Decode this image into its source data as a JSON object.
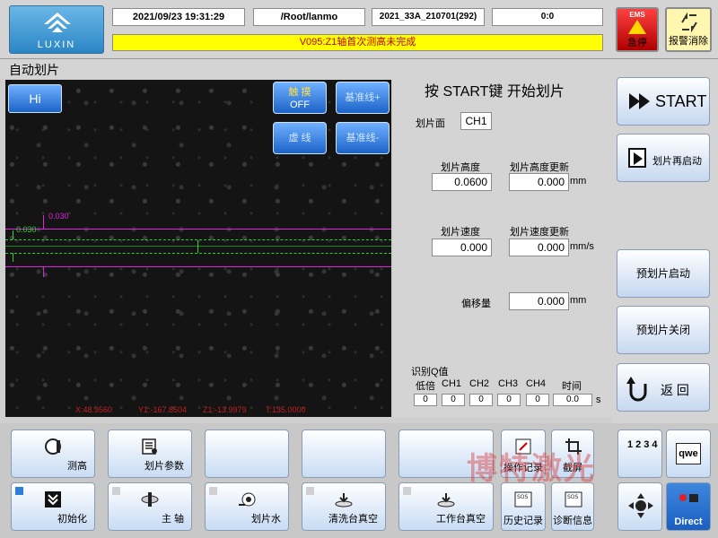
{
  "header": {
    "datetime": "2021/09/23 19:31:29",
    "path": "/Root/lanmo",
    "recipe": "2021_33A_210701(292)",
    "counter": "0:0",
    "alarm_message": "V095:Z1轴首次测高未完成",
    "logo_text": "LUXIN",
    "ems_top": "EMS",
    "ems_label": "急停",
    "alarm_clear_label": "报警消除"
  },
  "page_title": "自动划片",
  "camera": {
    "hi_label": "Hi",
    "touch_label_1": "触 摸",
    "touch_label_2": "OFF",
    "baseline_plus": "基准线+",
    "dashed_label": "虚 线",
    "baseline_minus": "基准线-",
    "marker_magenta": "0.030",
    "marker_green": "0.030",
    "status_x": "X:48.9560",
    "status_y": "Y1:-167.8504",
    "status_z": "Z1:-13.9979",
    "status_t": "T:135.0000",
    "colors": {
      "magenta": "#e020e0",
      "green": "#30d030"
    }
  },
  "panel": {
    "title": "按 START键 开始划片",
    "face_label": "划片面",
    "face_value": "CH1",
    "height_label": "划片高度",
    "height_value": "0.0600",
    "height_update_label": "划片高度更新",
    "height_update_value": "0.000",
    "height_unit": "mm",
    "speed_label": "划片速度",
    "speed_value": "0.000",
    "speed_update_label": "划片速度更新",
    "speed_update_value": "0.000",
    "speed_unit": "mm/s",
    "offset_label": "偏移量",
    "offset_value": "0.000",
    "offset_unit": "mm",
    "q_title": "识别Q值",
    "q_headers": [
      "低倍",
      "CH1",
      "CH2",
      "CH3",
      "CH4",
      "时间"
    ],
    "q_values": [
      "0",
      "0",
      "0",
      "0",
      "0",
      "0.0"
    ],
    "q_unit": "s"
  },
  "side": {
    "start": "START",
    "restart": "划片再启动",
    "pre_start": "预划片启动",
    "pre_close": "预划片关闭",
    "back": "返 回"
  },
  "bottom": {
    "measure": "测高",
    "params": "划片参数",
    "op_log": "操作记录",
    "screenshot": "截屏",
    "init": "初始化",
    "spindle": "主 轴",
    "water": "划片水",
    "clean_vac": "清洗台真空",
    "table_vac": "工作台真空",
    "history": "历史记录",
    "diag": "诊断信息",
    "keypad_label": "1234",
    "qwe_label": "qwe",
    "direct_label": "Direct",
    "watermark": "博特激光"
  }
}
